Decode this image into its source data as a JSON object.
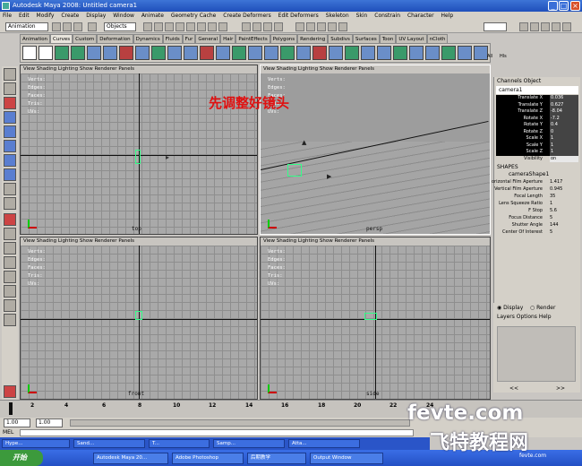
{
  "window": {
    "title": "Autodesk Maya 2008: Untitled    camera1"
  },
  "menu": [
    "File",
    "Edit",
    "Modify",
    "Create",
    "Display",
    "Window",
    "Animate",
    "Geometry Cache",
    "Create Deformers",
    "Edit Deformers",
    "Skeleton",
    "Skin",
    "Constrain",
    "Character",
    "Help"
  ],
  "statusline": {
    "mode": "Animation",
    "selection_mask": "Objects"
  },
  "shelf_tabs": [
    "Animation",
    "Curves",
    "Custom",
    "Deformation",
    "Dynamics",
    "Fluids",
    "Fur",
    "General",
    "Hair",
    "PaintEffects",
    "Polygons",
    "Rendering",
    "Subdivs",
    "Surfaces",
    "Toon",
    "UV Layout",
    "nCloth"
  ],
  "shelf_active_tab": "Curves",
  "shelf_end": {
    "all": "All",
    "hls": "Hls"
  },
  "viewport_menu": "View  Shading  Lighting  Show  Renderer  Panels",
  "hud_labels": [
    "Verts:",
    "Edges:",
    "Faces:",
    "Tris:",
    "UVs:"
  ],
  "viewports": {
    "top": {
      "label": "top"
    },
    "persp": {
      "label": "persp"
    },
    "front": {
      "label": "front"
    },
    "side": {
      "label": "side"
    }
  },
  "overlay_annotation": "先调整好镜头",
  "channel_box": {
    "header": "Channels  Object",
    "object_name": "camera1",
    "channels": [
      {
        "name": "Translate X",
        "value": "0.036"
      },
      {
        "name": "Translate Y",
        "value": "0.627"
      },
      {
        "name": "Translate Z",
        "value": "-8.04"
      },
      {
        "name": "Rotate X",
        "value": "-7.2"
      },
      {
        "name": "Rotate Y",
        "value": "0.4"
      },
      {
        "name": "Rotate Z",
        "value": "0"
      },
      {
        "name": "Scale X",
        "value": "1"
      },
      {
        "name": "Scale Y",
        "value": "1"
      },
      {
        "name": "Scale Z",
        "value": "1"
      },
      {
        "name": "Visibility",
        "value": "on"
      }
    ],
    "shapes_header": "SHAPES",
    "shape_name": "cameraShape1",
    "shape_attrs": [
      {
        "name": "orizontal Film Aperture",
        "value": "1.417"
      },
      {
        "name": "Vertical Film Aperture",
        "value": "0.945"
      },
      {
        "name": "Focal Length",
        "value": "35"
      },
      {
        "name": "Lens Squeeze Ratio",
        "value": "1"
      },
      {
        "name": "F Stop",
        "value": "5.6"
      },
      {
        "name": "Focus Distance",
        "value": "5"
      },
      {
        "name": "Shutter Angle",
        "value": "144"
      },
      {
        "name": "Center Of Interest",
        "value": "5"
      }
    ]
  },
  "layer_editor": {
    "display_label": "Display",
    "render_label": "Render",
    "menu": "Layers  Options  Help",
    "nav_prev": "<<",
    "nav_next": ">>"
  },
  "time_slider": {
    "ticks": [
      "2",
      "4",
      "6",
      "8",
      "10",
      "12",
      "14",
      "16",
      "18",
      "20",
      "22",
      "24"
    ]
  },
  "range_slider": {
    "start": "1.00",
    "current": "1.00"
  },
  "command_line": {
    "label": "MEL"
  },
  "taskbar_top": [
    {
      "label": "Hype..."
    },
    {
      "label": "Sand..."
    },
    {
      "label": "T..."
    },
    {
      "label": "Samp..."
    },
    {
      "label": "Atta..."
    }
  ],
  "taskbar_bottom": {
    "start": "开始",
    "items": [
      {
        "label": "Autodesk Maya 20..."
      },
      {
        "label": "Adobe Photoshop"
      },
      {
        "label": "后期教学"
      },
      {
        "label": "Output Window"
      }
    ]
  },
  "watermark": {
    "line1": "fevte.com",
    "line2": "飞特教程网",
    "line3": "fevte.com"
  }
}
